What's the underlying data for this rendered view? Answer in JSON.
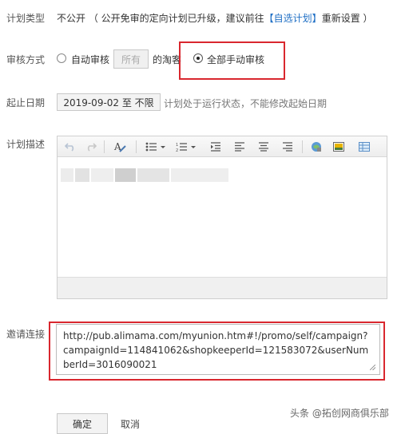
{
  "plan_type": {
    "label": "计划类型",
    "value": "不公开",
    "note_prefix": "（ 公开免审的定向计划已升级，建议前往",
    "note_link": "【自选计划】",
    "note_suffix": "重新设置 ）"
  },
  "review": {
    "label": "审核方式",
    "auto_label": "自动审核",
    "all_button": "所有",
    "taoke_text": "的淘客",
    "manual_label": "全部手动审核",
    "selected": "manual"
  },
  "dates": {
    "label": "起止日期",
    "value": "2019-09-02 至 不限",
    "note": "计划处于运行状态，不能修改起始日期"
  },
  "description": {
    "label": "计划描述",
    "toolbar": {
      "undo_icon": "undo-icon",
      "redo_icon": "redo-icon",
      "format_icon": "clear-format-icon",
      "bullet_icon": "bullet-list-icon",
      "number_icon": "numbered-list-icon",
      "indent_icon": "indent-icon",
      "align_left_icon": "align-left-icon",
      "align_center_icon": "align-center-icon",
      "align_right_icon": "align-right-icon",
      "link_icon": "link-icon",
      "image_icon": "image-icon",
      "table_icon": "table-icon"
    }
  },
  "invite": {
    "label": "邀请连接",
    "url": "http://pub.alimama.com/myunion.htm#!/promo/self/campaign?campaignId=114841062&shopkeeperId=121583072&userNumberId=3016090021"
  },
  "actions": {
    "confirm": "确定",
    "cancel": "取消"
  },
  "watermark": "头条 @拓创网商俱乐部",
  "colors": {
    "highlight": "#d9272e",
    "link": "#1f6fc5"
  }
}
